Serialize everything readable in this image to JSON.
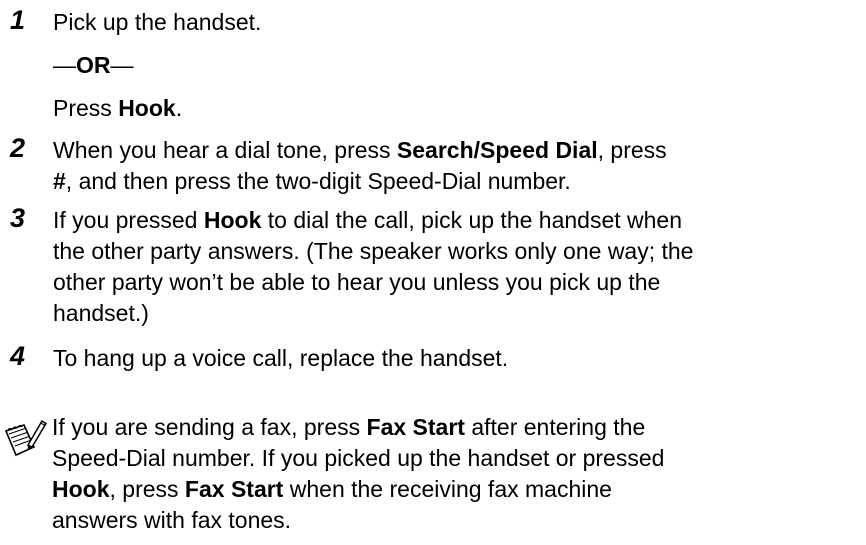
{
  "steps": [
    {
      "number": "1",
      "lines": [
        [
          {
            "t": "Pick up the handset."
          }
        ],
        [
          {
            "t": "—"
          },
          {
            "t": "OR",
            "b": true
          },
          {
            "t": "—"
          }
        ],
        [
          {
            "t": "Press "
          },
          {
            "t": "Hook",
            "b": true
          },
          {
            "t": "."
          }
        ]
      ]
    },
    {
      "number": "2",
      "lines": [
        [
          {
            "t": "When you hear a dial tone, press "
          },
          {
            "t": "Search/Speed Dial",
            "b": true
          },
          {
            "t": ", press"
          }
        ],
        [
          {
            "t": "#",
            "b": true
          },
          {
            "t": ", and then press the two-digit Speed-Dial number."
          }
        ]
      ]
    },
    {
      "number": "3",
      "lines": [
        [
          {
            "t": "If you pressed "
          },
          {
            "t": "Hook",
            "b": true
          },
          {
            "t": " to dial the call, pick up the handset when"
          }
        ],
        [
          {
            "t": "the other party answers. (The speaker works only one way; the"
          }
        ],
        [
          {
            "t": "other party won’t be able to hear you unless you pick up the"
          }
        ],
        [
          {
            "t": "handset.)"
          }
        ]
      ]
    },
    {
      "number": "4",
      "lines": [
        [
          {
            "t": "To hang up a voice call, replace the handset."
          }
        ]
      ]
    }
  ],
  "note": {
    "icon": "note-pencil-icon",
    "lines": [
      [
        {
          "t": "If you are sending a fax, press "
        },
        {
          "t": "Fax Start",
          "b": true
        },
        {
          "t": " after entering the"
        }
      ],
      [
        {
          "t": "Speed-Dial number. If you picked up the handset or pressed"
        }
      ],
      [
        {
          "t": "Hook",
          "b": true
        },
        {
          "t": ", press "
        },
        {
          "t": "Fax Start",
          "b": true
        },
        {
          "t": " when the receiving fax machine"
        }
      ],
      [
        {
          "t": "answers with fax tones."
        }
      ]
    ]
  }
}
